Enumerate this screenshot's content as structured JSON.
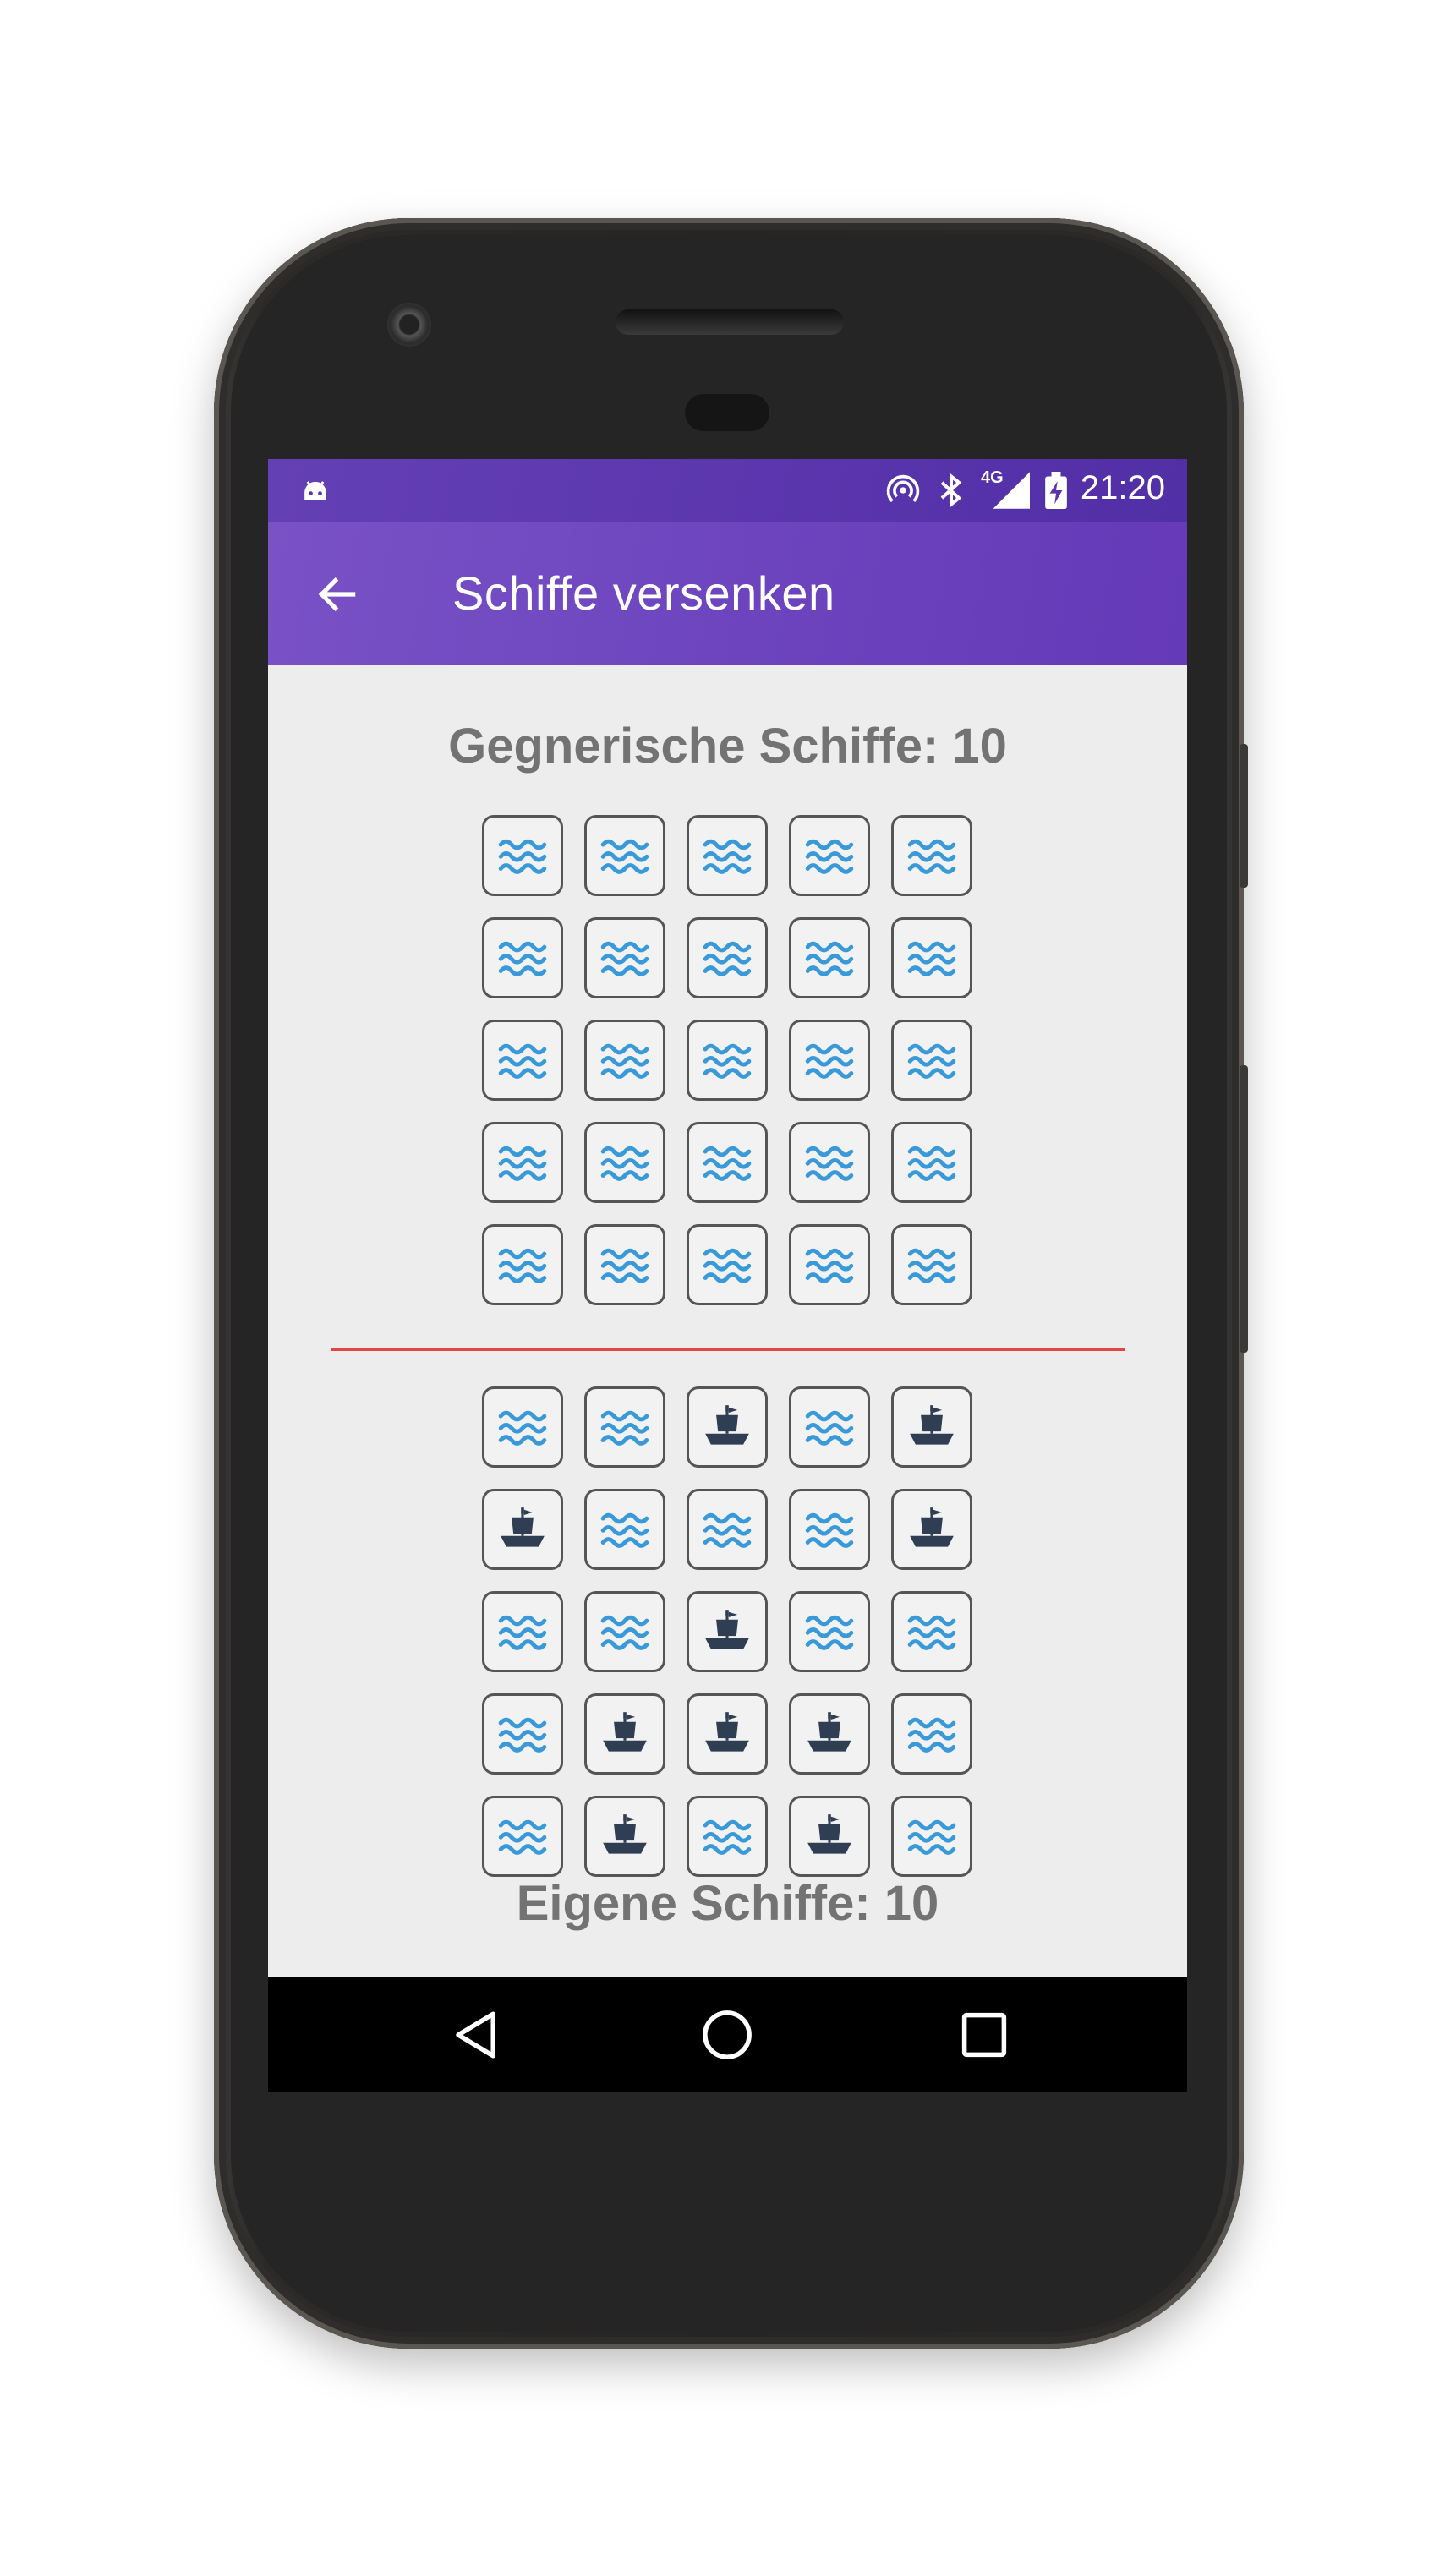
{
  "status_bar": {
    "time": "21:20",
    "network_label": "4G",
    "icons": [
      "android-debug-icon",
      "hotspot-icon",
      "bluetooth-icon",
      "signal-icon",
      "battery-charging-icon"
    ]
  },
  "app_bar": {
    "title": "Schiffe versenken",
    "back_icon": "arrow-left-icon"
  },
  "enemy": {
    "label": "Gegnerische Schiffe: 10",
    "grid": [
      [
        "water",
        "water",
        "water",
        "water",
        "water"
      ],
      [
        "water",
        "water",
        "water",
        "water",
        "water"
      ],
      [
        "water",
        "water",
        "water",
        "water",
        "water"
      ],
      [
        "water",
        "water",
        "water",
        "water",
        "water"
      ],
      [
        "water",
        "water",
        "water",
        "water",
        "water"
      ]
    ]
  },
  "own": {
    "label": "Eigene Schiffe: 10",
    "grid": [
      [
        "water",
        "water",
        "ship",
        "water",
        "ship"
      ],
      [
        "ship",
        "water",
        "water",
        "water",
        "ship"
      ],
      [
        "water",
        "water",
        "ship",
        "water",
        "water"
      ],
      [
        "water",
        "ship",
        "ship",
        "ship",
        "water"
      ],
      [
        "water",
        "ship",
        "water",
        "ship",
        "water"
      ]
    ]
  },
  "colors": {
    "status_bar": "#5a35ad",
    "app_bar": "#6e46bf",
    "water": "#3a9ad9",
    "ship": "#2f3e52",
    "divider": "#e04848",
    "label": "#737373",
    "background": "#ededed"
  },
  "nav_bar": {
    "icons": [
      "back-triangle-icon",
      "home-circle-icon",
      "recents-square-icon"
    ]
  }
}
